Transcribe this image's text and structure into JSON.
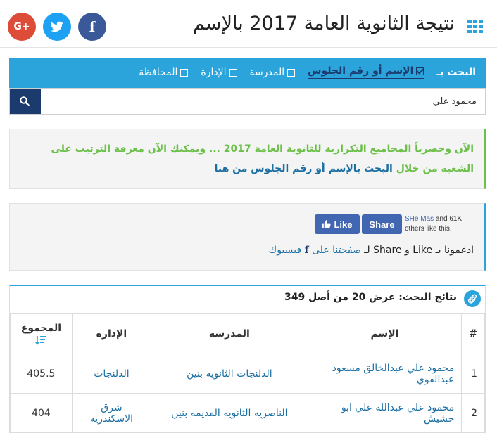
{
  "header": {
    "title": "نتيجة الثانوية العامة 2017 بالإسم",
    "social": {
      "gplus": "G+",
      "twitter": "t",
      "facebook": "f"
    }
  },
  "search": {
    "lead": "البحث بـ",
    "options": [
      {
        "label": "الإسم أو رقم الجلوس",
        "active": true
      },
      {
        "label": "المدرسة",
        "active": false
      },
      {
        "label": "الإدارة",
        "active": false
      },
      {
        "label": "المحافظة",
        "active": false
      }
    ],
    "value": "محمود علي"
  },
  "notice": {
    "part1": "الآن وحصرياً",
    "part2": "المجاميع التكرارية للثانوية العامة 2017 ... ويمكنك الآن معرفة الترتيب على الشعبة من خلال",
    "part3": "البحث بالإسم أو رقم الجلوس من هنا"
  },
  "facebook_box": {
    "like_label": "Like",
    "share_label": "Share",
    "friend_name": "SHe Mas",
    "count_text": "and 61K others like this.",
    "support_prefix": "ادعمونا بـ Like و Share لـ",
    "support_link": "صفحتنا على",
    "support_suffix": "فيسبوك"
  },
  "results": {
    "title": "نتائج البحث: عرض 20 من أصل 349",
    "columns": {
      "num": "#",
      "name": "الإسم",
      "school": "المدرسة",
      "admin": "الإدارة",
      "total": "المجموع"
    },
    "rows": [
      {
        "num": "1",
        "name": "محمود علي عبدالخالق مسعود عبدالقوي",
        "school": "الدلنجات الثانويه بنين",
        "admin": "الدلنجات",
        "total": "405.5"
      },
      {
        "num": "2",
        "name": "محمود علي عبدالله علي ابو حشيش",
        "school": "الناصريه الثانويه القديمه بنين",
        "admin": "شرق الاسكندريه",
        "total": "404"
      }
    ]
  },
  "colors": {
    "accent": "#2aa4da",
    "navy": "#1b3b6f",
    "green": "#6cc04a",
    "link": "#1b6fa3"
  }
}
